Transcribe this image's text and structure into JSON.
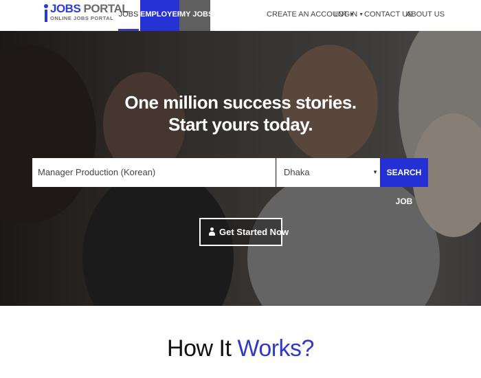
{
  "brand": {
    "logo_word1": "JOBS",
    "logo_word2": "PORTAL",
    "logo_tagline": "ONLINE JOBS PORTAL",
    "accent_color": "#2732d6"
  },
  "nav": {
    "jobs": "JOBS",
    "employers": "EMPLOYERS",
    "my_jobs": "MY JOBS",
    "create_account": "CREATE AN ACCOUNT",
    "login": "LOGIN",
    "contact_us": "CONTACT US",
    "about_us": "ABOUT US",
    "active_item": "jobs"
  },
  "hero": {
    "headline_line1": "One million success stories.",
    "headline_line2": "Start yours today.",
    "search": {
      "keyword_value": "Manager Production (Korean)",
      "location_value": "Dhaka",
      "button_label": "SEARCH JOB"
    },
    "cta_label": "Get Started Now"
  },
  "how_it_works": {
    "title_part1": "How It",
    "title_part2": "Works?"
  },
  "icons": {
    "logo": "i-person-logo-icon",
    "cta": "user-icon",
    "dropdown": "caret-down-icon"
  }
}
